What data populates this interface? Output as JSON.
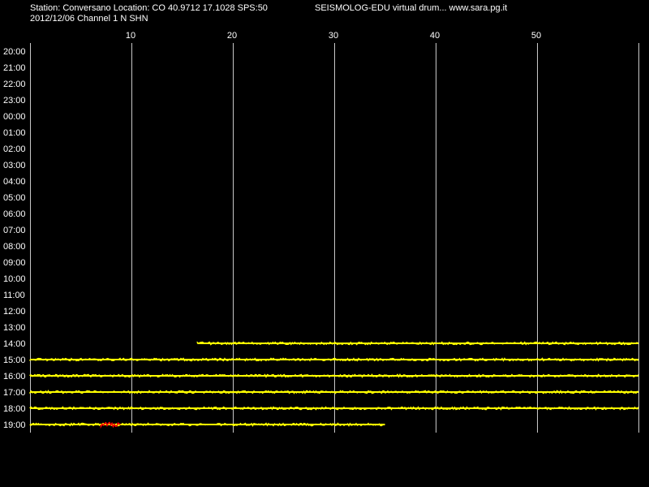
{
  "header": {
    "station_line": "Station: Conversano Location: CO 40.9712 17.1028 SPS:50",
    "app_line": "SEISMOLOG-EDU virtual drum... www.sara.pg.it",
    "date_line": "2012/12/06  Channel 1 N SHN"
  },
  "chart_data": {
    "type": "line",
    "title": "",
    "xlabel": "",
    "ylabel": "",
    "x_ticks": [
      10,
      20,
      30,
      40,
      50
    ],
    "xlim": [
      0,
      60
    ],
    "grid": true,
    "hour_labels": [
      "20:00",
      "21:00",
      "22:00",
      "23:00",
      "00:00",
      "01:00",
      "02:00",
      "03:00",
      "04:00",
      "05:00",
      "06:00",
      "07:00",
      "08:00",
      "09:00",
      "10:00",
      "11:00",
      "12:00",
      "13:00",
      "14:00",
      "15:00",
      "16:00",
      "17:00",
      "18:00",
      "19:00"
    ],
    "traces": [
      {
        "hour": "14:00",
        "start_min": 16.5,
        "end_min": 60
      },
      {
        "hour": "15:00",
        "start_min": 0,
        "end_min": 60
      },
      {
        "hour": "16:00",
        "start_min": 0,
        "end_min": 60
      },
      {
        "hour": "17:00",
        "start_min": 0,
        "end_min": 60
      },
      {
        "hour": "18:00",
        "start_min": 0,
        "end_min": 60
      },
      {
        "hour": "19:00",
        "start_min": 0,
        "end_min": 35
      }
    ],
    "events": [
      {
        "hour": "19:00",
        "start_min": 7.0,
        "end_min": 9.0
      }
    ],
    "colors": {
      "background": "#000000",
      "trace": "#ffff00",
      "event": "#ff0000",
      "grid": "#c8c8c8",
      "text": "#ffffff"
    }
  }
}
